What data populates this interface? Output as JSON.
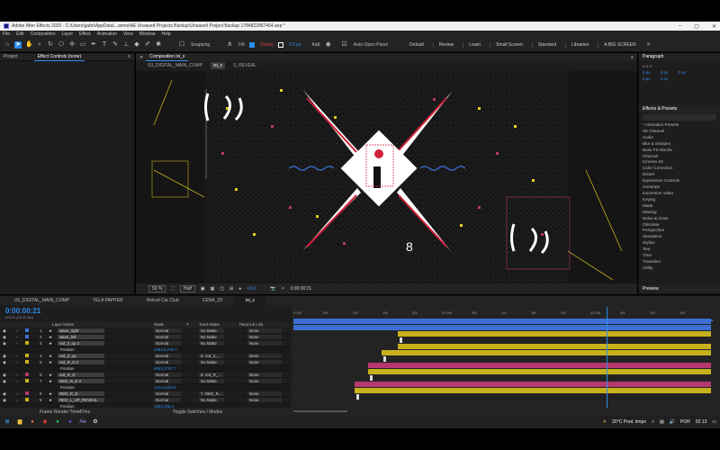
{
  "window": {
    "title": "Adobe After Effects 2025 - C:\\Users\\gabri\\AppData\\...ames\\AE Unsaved Projects Backup\\Unsaved Project Backup 1784822857464.aep *"
  },
  "menu": [
    "File",
    "Edit",
    "Composition",
    "Layer",
    "Effect",
    "Animation",
    "View",
    "Window",
    "Help"
  ],
  "toolbar": {
    "snapping": "Snapping",
    "fill": "Fill:",
    "stroke": "Stroke:",
    "stroke_px": "3.5 px",
    "add": "Add:",
    "auto_open": "Auto-Open Panel",
    "workspaces": [
      "Default",
      "Review",
      "Learn",
      "Small Screen",
      "Standard",
      "Libraries",
      "A BIG SCREEN"
    ]
  },
  "left_panel": {
    "tabs": [
      "Project",
      "Effect Controls (none)"
    ]
  },
  "composition": {
    "tab": "Composition lxi_x",
    "subtabs": [
      "ISI_DIGITAL_MAIN_COMP",
      "isi_x",
      "S_REVEAL"
    ],
    "zoom": "50 %",
    "resolution": "Half",
    "exposure": "+0,0",
    "timecode": "0:00:00:21"
  },
  "right_panel": {
    "paragraph": "Paragraph",
    "paragraph_fields": [
      "0 px",
      "0 px",
      "0 px",
      "0 px",
      "0 px"
    ],
    "effects_title": "Effects & Presets",
    "effects": [
      "* Animation Presets",
      "3D Channel",
      "Audio",
      "Blur & Sharpen",
      "Boris FX Mocha",
      "Channel",
      "Cinema 4D",
      "Color Correction",
      "Distort",
      "Expression Controls",
      "Generate",
      "Immersive Video",
      "Keying",
      "Matte",
      "Missing",
      "Noise & Grain",
      "Obsolete",
      "Perspective",
      "Simulation",
      "Stylize",
      "Text",
      "Time",
      "Transition",
      "Utility"
    ],
    "preview": "Preview"
  },
  "timeline": {
    "tabs": [
      "ISI_DIGITAL_MAIN_COMP",
      "TELA PAPPER",
      "Hotrod Car Club",
      "CENA_20",
      "isi_x"
    ],
    "timecode": "0:00:00:21",
    "fps": "00021 (25.00 fps)",
    "columns": {
      "layer": "Layer Name",
      "mode": "Mode",
      "t": "T",
      "track": "Track Matte",
      "parent": "Parent & Link"
    },
    "rows": [
      {
        "type": "layer",
        "num": "1",
        "name": "wave_right",
        "mode": "Normal",
        "matte": "No Matte",
        "parent": "None",
        "color": "#3c6fd4"
      },
      {
        "type": "layer",
        "num": "2",
        "name": "wave_left",
        "mode": "Normal",
        "matte": "No Matte",
        "parent": "None",
        "color": "#3c6fd4"
      },
      {
        "type": "layer",
        "num": "3",
        "name": "red_3_up 2",
        "mode": "Normal",
        "matte": "No Matte",
        "parent": "None",
        "color": "#c7b21c"
      },
      {
        "type": "prop",
        "name": "Position",
        "value": "3091,5,279,7"
      },
      {
        "type": "layer",
        "num": "4",
        "name": "red_3_up",
        "mode": "Normal",
        "matte": "5. red_3_...",
        "parent": "None",
        "color": "#c7b21c"
      },
      {
        "type": "layer",
        "num": "5",
        "name": "red_R_D 2",
        "mode": "Normal",
        "matte": "No Matte",
        "parent": "None",
        "color": "#c7b21c"
      },
      {
        "type": "prop",
        "name": "Position",
        "value": "6063,2797,7"
      },
      {
        "type": "layer",
        "num": "6",
        "name": "red_R_D",
        "mode": "Normal",
        "matte": "5. red_R_...",
        "parent": "None",
        "color": "#b5386e"
      },
      {
        "type": "layer",
        "num": "7",
        "name": "RED_R_D 2",
        "mode": "Normal",
        "matte": "No Matte",
        "parent": "None",
        "color": "#c7b21c"
      },
      {
        "type": "prop",
        "name": "Position",
        "value": "12214,803,0"
      },
      {
        "type": "layer",
        "num": "8",
        "name": "RED_R_D",
        "mode": "Normal",
        "matte": "7. RED_R...",
        "parent": "None",
        "color": "#b5386e"
      },
      {
        "type": "layer",
        "num": "9",
        "name": "RED_L_UP_REVEAL",
        "mode": "Normal",
        "matte": "No Matte",
        "parent": "None",
        "color": "#c7b21c"
      },
      {
        "type": "prop",
        "name": "Position",
        "value": "4593,285,4"
      }
    ],
    "ruler": [
      "0:00f",
      "05f",
      "10f",
      "15f",
      "20f",
      "01:00f",
      "05f",
      "10f",
      "15f",
      "20f",
      "02:00f",
      "05f",
      "10f",
      "15f"
    ],
    "frame_render": "Frame Render Time:",
    "frame_render_value": "47ms",
    "toggle": "Toggle Switches / Modes"
  },
  "taskbar": {
    "weather": "20°C Pred. limpo",
    "lang": "POR",
    "time": "02:13"
  }
}
